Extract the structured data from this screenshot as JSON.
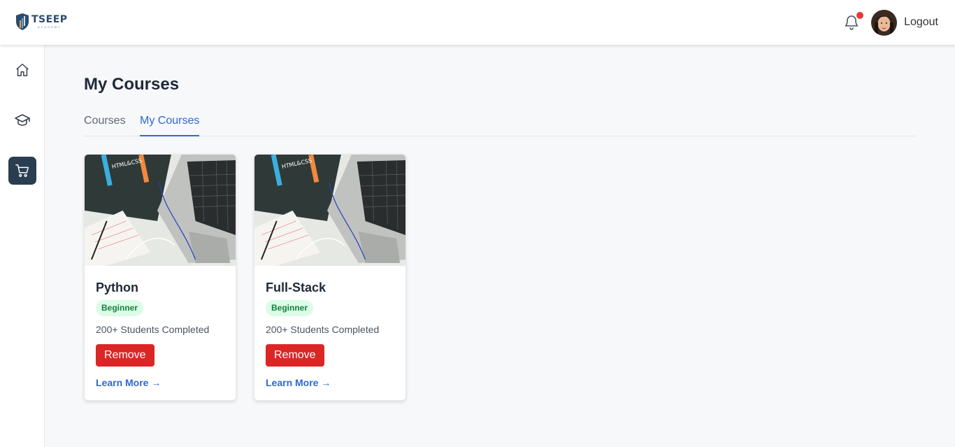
{
  "header": {
    "logo_name": "TSEEP",
    "logo_sub": "ACADEMY",
    "logout_label": "Logout",
    "notification_dot_color": "#e53935"
  },
  "sidebar": {
    "items": [
      {
        "icon": "home-icon",
        "active": false
      },
      {
        "icon": "graduation-cap-icon",
        "active": false
      },
      {
        "icon": "cart-icon",
        "active": true
      }
    ]
  },
  "main": {
    "title": "My Courses",
    "tabs": [
      {
        "label": "Courses",
        "active": false
      },
      {
        "label": "My Courses",
        "active": true
      }
    ],
    "courses": [
      {
        "title": "Python",
        "level": "Beginner",
        "students": "200+ Students Completed",
        "button": "Remove",
        "link": "Learn More →"
      },
      {
        "title": "Full-Stack",
        "level": "Beginner",
        "students": "200+ Students Completed",
        "button": "Remove",
        "link": "Learn More →"
      }
    ]
  },
  "colors": {
    "accent": "#2f68d0",
    "danger": "#dc2626",
    "sidebar_active": "#2a3d51",
    "badge_bg": "#dcfce7",
    "badge_text": "#15803d"
  }
}
